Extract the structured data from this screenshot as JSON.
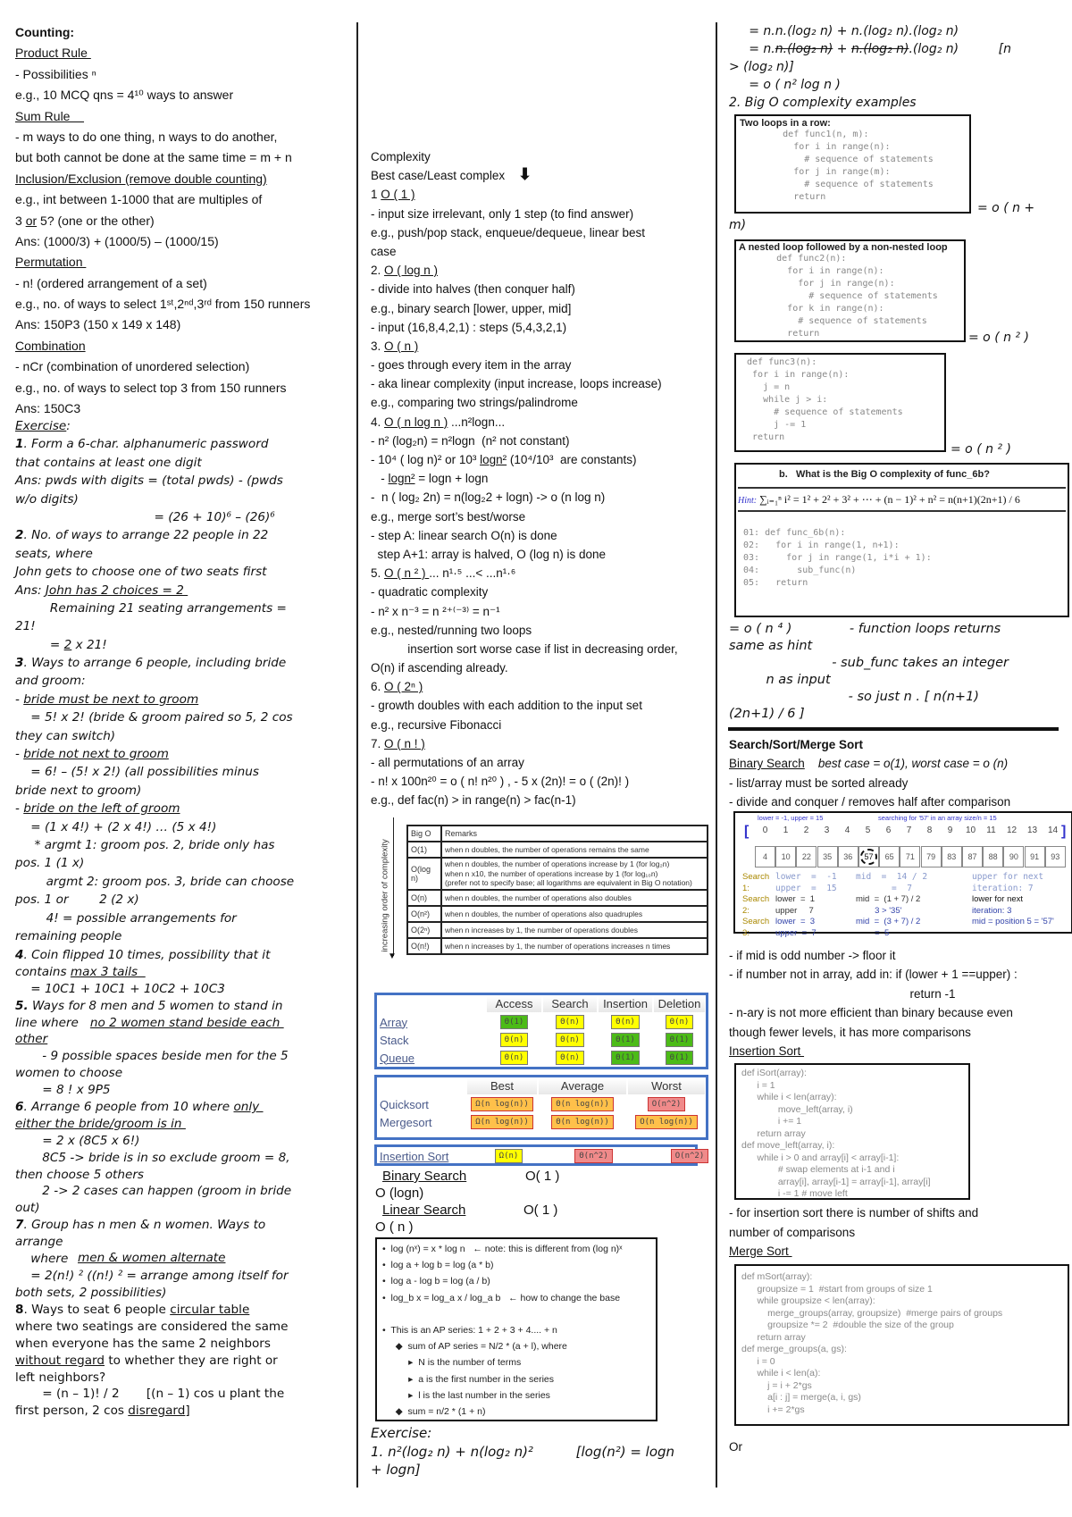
{
  "left": {
    "counting": [
      [
        {
          "t": "Counting:",
          "b": true
        }
      ],
      [
        {
          "t": "Product Rule ",
          "u": true
        }
      ],
      "- Possibilities ⁿ",
      "e.g., 10 MCQ qns = 4¹⁰ ways to answer",
      [
        {
          "t": "Sum Rule    ",
          "u": true
        }
      ],
      "- m ways to do one thing, n ways to do another,",
      "but both cannot be done at the same time = m + n",
      [
        {
          "t": "Inclusion/Exclusion (remove double counting)",
          "u": true
        }
      ],
      "e.g., int between 1-1000 that are multiples of",
      [
        "3 ",
        {
          "t": "or",
          "u": true
        },
        " 5? (one or the other)"
      ],
      "Ans: (1000/3) + (1000/5) – (1000/15)",
      [
        {
          "t": "Permutation ",
          "u": true
        }
      ],
      "- n! (ordered arrangement of a set)",
      "e.g., no. of ways to select 1ˢᵗ,2ⁿᵈ,3ʳᵈ from 150 runners",
      "Ans: 150P3 (150 x 149 x 148)",
      [
        {
          "t": "Combination",
          "u": true
        }
      ],
      "- nCr (combination of unordered selection)",
      "e.g., no. of ways to select top 3 from 150 runners",
      "Ans: 150C3"
    ],
    "exercise_a": [
      [
        {
          "t": "Exercise",
          "u": true
        },
        ":"
      ],
      [
        {
          "t": "1",
          "b": true
        },
        ". Form a 6-char. alphanumeric password"
      ],
      "that contains at least one digit",
      "Ans: pwds with digits = (total pwds) - (pwds",
      "w/o digits)",
      "                                    = (26 + 10)⁶ – (26)⁶",
      [
        {
          "t": "2",
          "b": true
        },
        ". No. of ways to arrange 22 people in 22"
      ],
      "seats, where",
      "John gets to choose one of two seats first",
      [
        "Ans: ",
        {
          "t": "John has 2 choices = 2 ",
          "u": true
        }
      ],
      "         Remaining 21 seating arrangements =",
      "21!",
      [
        "         = ",
        {
          "t": "2",
          "u": true
        },
        " x 21!"
      ],
      [
        {
          "t": "3",
          "b": true
        },
        ". Ways to arrange 6 people, including bride"
      ],
      "and groom:",
      [
        "- ",
        {
          "t": "bride must be next to groom",
          "u": true
        }
      ],
      "    = 5! x 2! (bride & groom paired so 5, 2 cos",
      "they can switch)",
      [
        "- ",
        {
          "t": "bride not next to groom",
          "u": true
        }
      ],
      "    = 6! – (5! x 2!) (all possibilities minus",
      "bride next to groom)",
      [
        "- ",
        {
          "t": "bride on the left of groom",
          "u": true
        }
      ],
      "    = (1 x 4!) + (2 x 4!) … (5 x 4!)",
      "     * argmt 1: groom pos. 2, bride only has",
      "pos. 1 (1 x)",
      "        argmt 2: groom pos. 3, bride can choose",
      "pos. 1 or        2 (2 x)",
      "        4! = possible arrangements for",
      "remaining people"
    ],
    "exercise_b": [
      [
        {
          "t": "4",
          "b": true
        },
        ". Coin flipped 10 times, possibility that it"
      ],
      [
        "contains ",
        {
          "t": "max 3 tails  ",
          "u": true
        }
      ],
      "    = 10C1 + 10C1 + 10C2 + 10C3",
      [
        {
          "t": "5.",
          "b": true
        },
        " Ways for 8 men and 5 women to stand in"
      ],
      [
        "line where   ",
        {
          "t": "no 2 women stand beside each ",
          "u": true
        }
      ],
      [
        {
          "t": "other",
          "u": true
        }
      ],
      "       - 9 possible spaces beside men for the 5",
      "women to choose",
      "       = 8 ! x 9P5",
      [
        {
          "t": "6",
          "b": true
        },
        ". Arrange 6 people from 10 where ",
        {
          "t": "only ",
          "u": true
        }
      ],
      [
        {
          "t": "either the bride/groom is in ",
          "u": true
        }
      ],
      "       = 2 x (8C5 x 6!)",
      "       8C5 -> bride is in so exclude groom = 8,",
      "then choose 5 others",
      "       2 -> 2 cases can happen (groom in bride",
      "out)",
      [
        {
          "t": "7",
          "b": true
        },
        ". Group has n men & n women. Ways to"
      ],
      "arrange",
      "    where ",
      "    = 2(n!) ² ((n!) ² = arrange among itself for",
      "both sets, 2 possibilities)"
    ],
    "exercise_b_where_underline": "men & women alternate",
    "exercise_c": [
      [
        {
          "t": "8",
          "b": true
        },
        ". Ways to seat 6 people ",
        {
          "t": "circular table",
          "u": true
        }
      ],
      "where two seatings are considered the same",
      "when everyone has the same 2 neighbors",
      [
        {
          "t": "without regard",
          "u": true
        },
        " to whether they are right or"
      ],
      "left neighbors?",
      "       = (n – 1)! / 2       [(n – 1) cos u plant the",
      [
        "first person, 2 cos ",
        {
          "t": "disregard",
          "u": true
        },
        "]"
      ]
    ]
  },
  "middle": {
    "complexity": [
      "Complexity",
      "Best case/Least complex  ",
      [
        "1 ",
        {
          "t": "O ( 1 )",
          "u": true
        }
      ],
      "- input size irrelevant, only 1 step (to find answer)",
      "e.g., push/pop stack, enqueue/dequeue, linear best",
      "case",
      [
        "2. ",
        {
          "t": "O ( log n )",
          "u": true
        }
      ],
      "- divide into halves (then conquer half)",
      "e.g., binary search [lower, upper, mid]",
      "- input (16,8,4,2,1) : steps (5,4,3,2,1)",
      [
        "3. ",
        {
          "t": "O ( n )",
          "u": true
        }
      ],
      "- goes through every item in the array",
      "- aka linear complexity (input increase, loops increase)",
      "e.g., comparing two strings/palindrome",
      [
        "4. ",
        {
          "t": "O ( n log n )",
          "u": true
        },
        " ...n²logn..."
      ],
      "- n² (log₂n) = n²logn  (n² not constant)",
      [
        "- 10⁴ ( log n)² or 10³ ",
        {
          "t": "logn²",
          "u": true
        },
        " (10⁴/10³  are constants)"
      ],
      [
        "   - ",
        {
          "t": "logn²",
          "u": true
        },
        " = logn + logn"
      ],
      "-  n ( log₂ 2n) = n(log₂2 + logn) -> o (n log n)",
      "e.g., merge sort’s best/worse",
      "- step A: linear search O(n) is done",
      "  step A+1: array is halved, O (log n) is done",
      [
        "5. ",
        {
          "t": "O ( n ² ) ",
          "u": true
        },
        "... n¹·⁵ ...< ...n¹·⁶"
      ],
      "- quadratic complexity",
      "- n² x n⁻³ = n ²⁺⁽⁻³⁾ = n⁻¹",
      "e.g., nested/running two loops",
      "           insertion sort worse case if list in decreasing order,",
      "O(n) if ascending already.",
      [
        "6. ",
        {
          "t": "O ( 2ⁿ )",
          "u": true
        }
      ],
      "- growth doubles with each addition to the input set",
      "e.g., recursive Fibonacci",
      [
        "7. ",
        {
          "t": "O ( n ! )",
          "u": true
        }
      ],
      "- all permutations of an array",
      "- n! x 100n²⁰ = o ( n! n²⁰ ) , - 5 x (2n)! = o ( (2n)! )",
      "e.g., def fac(n) > in range(n) > fac(n-1)"
    ],
    "bigo_table": {
      "axis_label": "increasing order of complexity",
      "header": [
        "Big O",
        "Remarks"
      ],
      "rows": [
        [
          "O(1)",
          "when n doubles, the number of operations remains the same"
        ],
        [
          "O(log n)",
          "when n doubles, the number of operations increase by 1 (for log₂n)\nwhen n x10, the number of operations increase by 1 (for log₁₀n)\n(prefer not to specify base; all logarithms are equivalent in Big O notation)"
        ],
        [
          "O(n)",
          "when n doubles, the number of operations also doubles"
        ],
        [
          "O(n²)",
          "when n doubles, the number of operations also quadruples"
        ],
        [
          "O(2ⁿ)",
          "when n increases by 1, the number of operations doubles"
        ],
        [
          "O(n!)",
          "when n increases by 1, the number of operations increases n times"
        ]
      ]
    },
    "ds_table": {
      "header": [
        "",
        "Access",
        "Search",
        "Insertion",
        "Deletion"
      ],
      "rows": [
        {
          "label": "Array",
          "cells": [
            [
              "Θ(1)",
              "g"
            ],
            [
              "Θ(n)",
              "y"
            ],
            [
              "Θ(n)",
              "y"
            ],
            [
              "Θ(n)",
              "y"
            ]
          ]
        },
        {
          "label": "Stack",
          "cells": [
            [
              "Θ(n)",
              "y"
            ],
            [
              "Θ(n)",
              "y"
            ],
            [
              "Θ(1)",
              "g"
            ],
            [
              "Θ(1)",
              "g"
            ]
          ]
        },
        {
          "label": "Queue",
          "cells": [
            [
              "Θ(n)",
              "y"
            ],
            [
              "Θ(n)",
              "y"
            ],
            [
              "Θ(1)",
              "g"
            ],
            [
              "Θ(1)",
              "g"
            ]
          ]
        }
      ]
    },
    "sort_table": {
      "header": [
        "",
        "Best",
        "Average",
        "Worst"
      ],
      "rows": [
        {
          "label": "Quicksort",
          "cells": [
            [
              "Ω(n log(n))",
              "o"
            ],
            [
              "Θ(n log(n))",
              "o"
            ],
            [
              "O(n^2)",
              "p"
            ]
          ]
        },
        {
          "label": "Mergesort",
          "cells": [
            [
              "Ω(n log(n))",
              "o"
            ],
            [
              "Θ(n log(n))",
              "o"
            ],
            [
              "O(n log(n))",
              "o"
            ]
          ]
        }
      ]
    },
    "insertion_row": {
      "label": "Insertion Sort",
      "cells": [
        [
          "Ω(n)",
          "y"
        ],
        [
          "Θ(n^2)",
          "p"
        ],
        [
          "O(n^2)",
          "p"
        ]
      ]
    },
    "search_lines": {
      "binary_label": "Binary Search",
      "binary_best": "O( 1 )",
      "binary_worst": "O (logn)",
      "linear_label": "Linear Search",
      "linear_best": "O( 1 )",
      "linear_worst": "O ( n )"
    },
    "log_box": [
      "•  log (nˣ) = x * log n   ← note: this is different from (log n)ˣ",
      "•  log a + log b = log (a * b)",
      "•  log a - log b = log (a / b)",
      "•  log_b x = log_a x / log_a b   ← how to change the base",
      "",
      "•  This is an AP series: 1 + 2 + 3 + 4.... + n",
      "     ◆  sum of AP series = N/2 * (a + l), where",
      "          ▸  N is the number of terms",
      "          ▸  a is the first number in the series",
      "          ▸  l is the last number in the series",
      "     ◆  sum = n/2 * (1 + n)"
    ],
    "exercise": [
      "Exercise:",
      "1. n²(log₂ n) + n(log₂ n)²          [log(n²) = logn",
      "+ logn]"
    ]
  },
  "right": {
    "math": [
      "     = n.n.(log₂ n) + n.(log₂ n).(log₂ n)",
      [
        "     = n.",
        {
          "t": "n.(log₂ n)",
          "s": true
        },
        " + ",
        {
          "t": "n.(log₂ n)",
          "s": true
        },
        ".(log₂ n)          [n"
      ],
      "> (log₂ n)]",
      "     = o ( n² log n )",
      "2. Big O complexity examples"
    ],
    "box1": {
      "title": "Two loops in a row:",
      "code": [
        "        def func1(n, m):",
        "          for i in range(n):",
        "            # sequence of statements",
        "          for j in range(m):",
        "            # sequence of statements",
        "          return"
      ],
      "result": "= o ( n +",
      "result2": "m)"
    },
    "box2": {
      "title": "A nested loop followed by a non-nested loop",
      "code": [
        "       def func2(n):",
        "         for i in range(n):",
        "           for j in range(n):",
        "             # sequence of statements",
        "         for k in range(n):",
        "           # sequence of statements",
        "         return"
      ],
      "result": "= o ( n ² )"
    },
    "box3": {
      "code": [
        " def func3(n):",
        "  for i in range(n):",
        "    j = n",
        "    while j > i:",
        "      # sequence of statements",
        "      j -= 1",
        "  return"
      ],
      "result": "= o ( n ² )"
    },
    "box4": {
      "title": "b.   What is the Big O complexity of func_6b?",
      "hint_label": "Hint:",
      "hint": "∑ᵢ₌₁ⁿ i² = 1² + 2² + 3² + ⋯ + (n − 1)² + n² = n(n+1)(2n+1) / 6",
      "code": [
        "01: def func_6b(n):",
        "02:   for i in range(1, n+1):",
        "03:     for j in range(1, i*i + 1):",
        "04:       sub_func(n)",
        "05:   return"
      ]
    },
    "after_box4": [
      "= o ( n ⁴ )              - function loops returns",
      "same as hint",
      "                         - sub_func takes an integer",
      "         n as input",
      "                             - so just n . [ n(n+1)",
      "(2n+1) / 6 ]"
    ],
    "search_head": [
      [
        {
          "t": "Search/Sort/Merge Sort",
          "b": true
        }
      ],
      [
        {
          "t": "Binary Search",
          "u": true
        },
        "    ",
        {
          "t": "best case = o(1), worst case = o (n)",
          "i": true
        }
      ],
      "- list/array must be sorted already",
      "- divide and conquer / removes half after comparison"
    ],
    "array_box": {
      "note_left": "lower = -1, upper = 15",
      "note_right": "searching for '57' in an array size/n = 15",
      "indices": [
        "0",
        "1",
        "2",
        "3",
        "4",
        "5",
        "6",
        "7",
        "8",
        "9",
        "10",
        "11",
        "12",
        "13",
        "14"
      ],
      "values": [
        "4",
        "10",
        "22",
        "35",
        "36",
        "57",
        "65",
        "71",
        "79",
        "83",
        "87",
        "88",
        "90",
        "91",
        "93"
      ],
      "found_index": 5,
      "steps": [
        [
          "Search",
          "lower  =  -1",
          "mid  =  14 / 2",
          "upper for next"
        ],
        [
          "1:",
          "upper  =  15",
          "       =  7",
          "iteration: 7"
        ],
        [
          "Search",
          "lower  =  1",
          "mid  =  (1 + 7) / 2",
          "lower for next"
        ],
        [
          "2:",
          "upper     7",
          "        3 > '35'",
          "iteration: 3"
        ],
        [
          "Search",
          "lower  =  3",
          "mid  =  (3 + 7) / 2",
          "mid = position 5 = '57'"
        ],
        [
          "3:",
          "upper  =  7",
          "        =  5",
          ""
        ]
      ]
    },
    "search_notes": [
      "- if mid is odd number -> floor it",
      "- if number not in array, add in: if (lower + 1 ==upper) :",
      "                                                      return -1",
      "- n-ary is not more efficient than binary because even",
      "though fewer levels, it has more comparisons",
      [
        {
          "t": "Insertion Sort ",
          "u": true
        }
      ]
    ],
    "insertion_code": [
      "def iSort(array):",
      "      i = 1",
      "      while i < len(array):",
      "              move_left(array, i)",
      "              i += 1",
      "      return array",
      "def move_left(array, i):",
      "      while i > 0 and array[i] < array[i-1]:",
      "              # swap elements at i-1 and i",
      "              array[i], array[i-1] = array[i-1], array[i]",
      "              i -= 1 # move left"
    ],
    "insertion_notes": [
      "- for insertion sort there is number of shifts and",
      "number of comparisons",
      [
        {
          "t": "Merge Sort ",
          "u": true
        }
      ]
    ],
    "merge_code": [
      "def mSort(array):",
      "      groupsize = 1  #start from groups of size 1",
      "      while groupsize < len(array):",
      "          merge_groups(array, groupsize)  #merge pairs of groups",
      "          groupsize *= 2  #double the size of the group",
      "      return array",
      "def merge_groups(a, gs):",
      "      i = 0",
      "      while i < len(a):",
      "          j = i + 2*gs",
      "          a[i : j] = merge(a, i, gs)",
      "          i += 2*gs"
    ],
    "or_label": "Or"
  },
  "colors": {
    "green": "#4cbb17",
    "yellow": "#ffff00",
    "orange": "#ffc04a",
    "pink": "#f08a8a",
    "table_border": "#4472c4"
  }
}
